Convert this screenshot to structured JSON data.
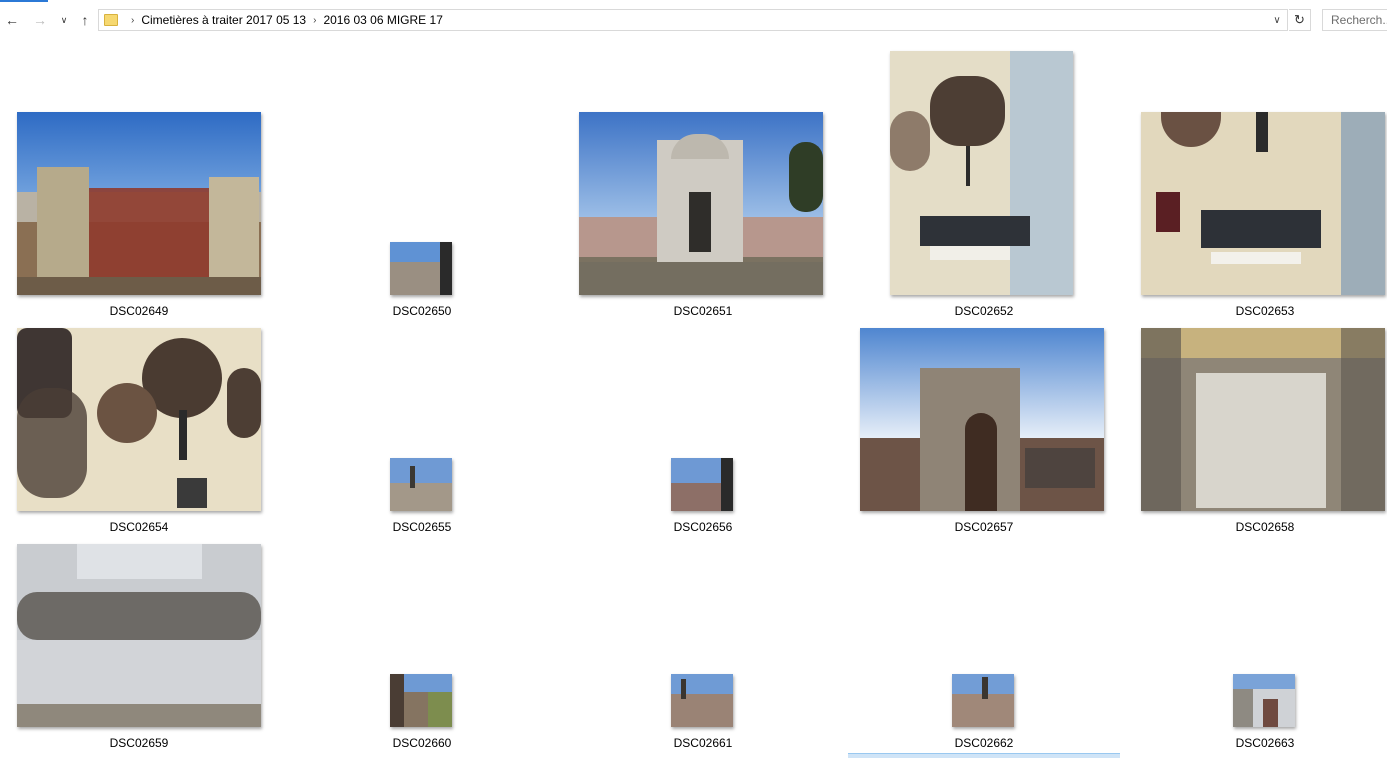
{
  "toolbar": {
    "back_icon": "arrow-left-icon",
    "forward_icon": "arrow-right-icon",
    "recent_icon": "chevron-down-icon",
    "up_icon": "arrow-up-icon"
  },
  "address": {
    "breadcrumbs": [
      "Cimetières à traiter 2017 05 13",
      "2016 03 06 MIGRE 17"
    ]
  },
  "search": {
    "placeholder": "Recherch..."
  },
  "files": [
    "DSC02649",
    "DSC02650",
    "DSC02651",
    "DSC02652",
    "DSC02653",
    "DSC02654",
    "DSC02655",
    "DSC02656",
    "DSC02657",
    "DSC02658",
    "DSC02659",
    "DSC02660",
    "DSC02661",
    "DSC02662",
    "DSC02663"
  ],
  "colors": {
    "accent": "#2b79d6",
    "selection": "#cfe4f7"
  }
}
